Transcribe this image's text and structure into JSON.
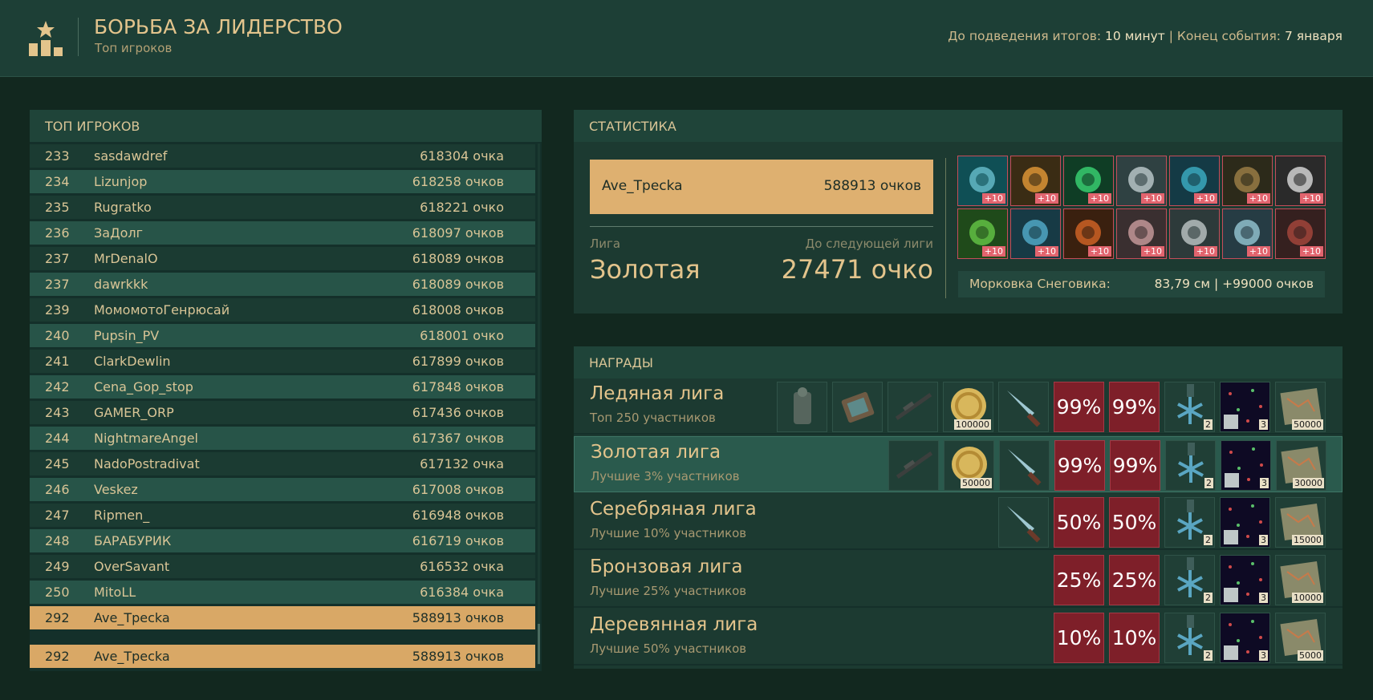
{
  "header": {
    "title": "БОРЬБА ЗА ЛИДЕРСТВО",
    "subtitle": "Топ игроков",
    "results_label": "До подведения итогов:",
    "results_value": "10 минут",
    "sep": "|",
    "end_label": "Конец события:",
    "end_value": "7 января",
    "logo_icon": "leaderboard-podium-star-icon"
  },
  "top": {
    "title": "ТОП ИГРОКОВ",
    "rows": [
      {
        "rank": "233",
        "name": "sasdawdref",
        "score": "618304 очка"
      },
      {
        "rank": "234",
        "name": "Lizunjop",
        "score": "618258 очков"
      },
      {
        "rank": "235",
        "name": "Rugratko",
        "score": "618221 очко"
      },
      {
        "rank": "236",
        "name": "ЗаДолг",
        "score": "618097 очков"
      },
      {
        "rank": "237",
        "name": "MrDenalO",
        "score": "618089 очков"
      },
      {
        "rank": "237",
        "name": "dawrkkk",
        "score": "618089 очков"
      },
      {
        "rank": "239",
        "name": "МомомотоГенрюсай",
        "score": "618008 очков"
      },
      {
        "rank": "240",
        "name": "Pupsin_PV",
        "score": "618001 очко"
      },
      {
        "rank": "241",
        "name": "ClarkDewlin",
        "score": "617899 очков"
      },
      {
        "rank": "242",
        "name": "Cena_Gop_stop",
        "score": "617848 очков"
      },
      {
        "rank": "243",
        "name": "GAMER_ORP",
        "score": "617436 очков"
      },
      {
        "rank": "244",
        "name": "NightmareAngel",
        "score": "617367 очков"
      },
      {
        "rank": "245",
        "name": "NadoPostradivat",
        "score": "617132 очка"
      },
      {
        "rank": "246",
        "name": "Veskez",
        "score": "617008 очков"
      },
      {
        "rank": "247",
        "name": "Ripmen_",
        "score": "616948 очков"
      },
      {
        "rank": "248",
        "name": "БАРАБУРИК",
        "score": "616719 очков"
      },
      {
        "rank": "249",
        "name": "OverSavant",
        "score": "616532 очка"
      },
      {
        "rank": "250",
        "name": "MitoLL",
        "score": "616384 очка"
      },
      {
        "rank": "292",
        "name": "Ave_Трecka",
        "score": "588913 очков"
      }
    ],
    "self": {
      "rank": "292",
      "name": "Ave_Трecka",
      "score": "588913 очков"
    }
  },
  "stats": {
    "title": "СТАТИСТИКА",
    "player_name": "Ave_Трecka",
    "player_score": "588913 очков",
    "league_label": "Лига",
    "league_value": "Золотая",
    "next_label": "До следующей лиги",
    "next_value": "27471 очко",
    "bonus_tag": "+10",
    "bonuses": [
      "blue-spore-icon",
      "flame-drops-icon",
      "green-crystals-icon",
      "hook-worm-icon",
      "blue-jelly-icon",
      "brown-egg-icon",
      "white-claw-icon",
      "green-grass-icon",
      "blue-drops-icon",
      "orange-helix-icon",
      "pink-rock-icon",
      "white-urchin-icon",
      "white-spore-icon",
      "red-mushroom-icon"
    ],
    "carrot_label": "Морковка Снеговика:",
    "carrot_value": "83,79 см | +99000 очков"
  },
  "rewards": {
    "title": "НАГРАДЫ",
    "leagues": [
      {
        "name": "Ледяная лига",
        "desc": "Топ 250 участников",
        "items": [
          {
            "icon": "armor-suit-icon"
          },
          {
            "icon": "detector-device-icon"
          },
          {
            "icon": "sniper-rifle-icon"
          },
          {
            "icon": "gold-coin-icon",
            "count": "100000"
          },
          {
            "icon": "knife-icon"
          },
          {
            "icon": "weapon-boost-icon",
            "pct": "99%"
          },
          {
            "icon": "backpack-boost-icon",
            "pct": "99%"
          },
          {
            "icon": "snowflake-medal-icon",
            "count": "2"
          },
          {
            "icon": "mystery-box-icon",
            "count": "3"
          },
          {
            "icon": "map-icon",
            "count": "50000"
          }
        ]
      },
      {
        "name": "Золотая лига",
        "desc": "Лучшие 3% участников",
        "items": [
          {
            "icon": "sniper-rifle-icon"
          },
          {
            "icon": "gold-coin-icon",
            "count": "50000"
          },
          {
            "icon": "knife-icon"
          },
          {
            "icon": "weapon-boost-icon",
            "pct": "99%"
          },
          {
            "icon": "backpack-boost-icon",
            "pct": "99%"
          },
          {
            "icon": "snowflake-medal-icon",
            "count": "2"
          },
          {
            "icon": "mystery-box-icon",
            "count": "3"
          },
          {
            "icon": "map-icon",
            "count": "30000"
          }
        ]
      },
      {
        "name": "Серебряная лига",
        "desc": "Лучшие 10% участников",
        "items": [
          {
            "icon": "knife-icon"
          },
          {
            "icon": "weapon-boost-icon",
            "pct": "50%"
          },
          {
            "icon": "backpack-boost-icon",
            "pct": "50%"
          },
          {
            "icon": "snowflake-medal-icon",
            "count": "2"
          },
          {
            "icon": "mystery-box-icon",
            "count": "3"
          },
          {
            "icon": "map-icon",
            "count": "15000"
          }
        ]
      },
      {
        "name": "Бронзовая лига",
        "desc": "Лучшие 25% участников",
        "items": [
          {
            "icon": "weapon-boost-icon",
            "pct": "25%"
          },
          {
            "icon": "backpack-boost-icon",
            "pct": "25%"
          },
          {
            "icon": "snowflake-medal-icon",
            "count": "2"
          },
          {
            "icon": "mystery-box-icon",
            "count": "3"
          },
          {
            "icon": "map-icon",
            "count": "10000"
          }
        ]
      },
      {
        "name": "Деревянная лига",
        "desc": "Лучшие 50% участников",
        "items": [
          {
            "icon": "weapon-boost-icon",
            "pct": "10%"
          },
          {
            "icon": "backpack-boost-icon",
            "pct": "10%"
          },
          {
            "icon": "snowflake-medal-icon",
            "count": "2"
          },
          {
            "icon": "mystery-box-icon",
            "count": "3"
          },
          {
            "icon": "map-icon",
            "count": "5000"
          }
        ]
      }
    ]
  }
}
